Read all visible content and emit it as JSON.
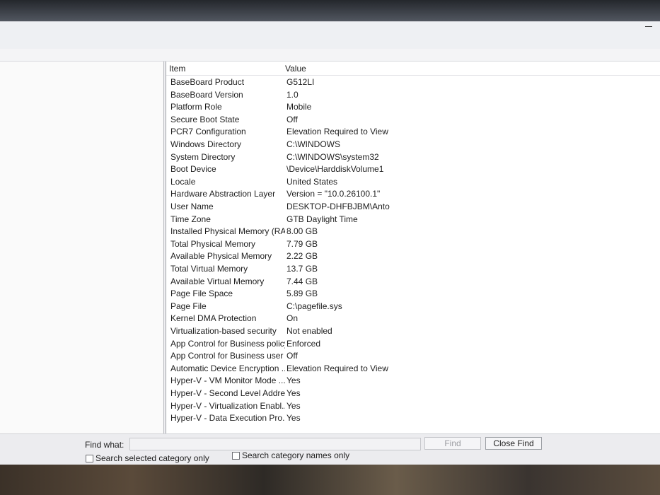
{
  "find_bar": {
    "label": "Find what:",
    "input_value": "",
    "find_label": "Find",
    "close_label": "Close Find",
    "option_selected_category": "Search selected category only",
    "option_category_names": "Search category names only"
  },
  "list": {
    "columns": {
      "item": "Item",
      "value": "Value"
    },
    "rows": [
      {
        "item": "BaseBoard Product",
        "value": "G512LI"
      },
      {
        "item": "BaseBoard Version",
        "value": "1.0"
      },
      {
        "item": "Platform Role",
        "value": "Mobile"
      },
      {
        "item": "Secure Boot State",
        "value": "Off"
      },
      {
        "item": "PCR7 Configuration",
        "value": "Elevation Required to View"
      },
      {
        "item": "Windows Directory",
        "value": "C:\\WINDOWS"
      },
      {
        "item": "System Directory",
        "value": "C:\\WINDOWS\\system32"
      },
      {
        "item": "Boot Device",
        "value": "\\Device\\HarddiskVolume1"
      },
      {
        "item": "Locale",
        "value": "United States"
      },
      {
        "item": "Hardware Abstraction Layer",
        "value": "Version = \"10.0.26100.1\""
      },
      {
        "item": "User Name",
        "value": "DESKTOP-DHFBJBM\\Anto"
      },
      {
        "item": "Time Zone",
        "value": "GTB Daylight Time"
      },
      {
        "item": "Installed Physical Memory (RA...",
        "value": "8.00 GB"
      },
      {
        "item": "Total Physical Memory",
        "value": "7.79 GB"
      },
      {
        "item": "Available Physical Memory",
        "value": "2.22 GB"
      },
      {
        "item": "Total Virtual Memory",
        "value": "13.7 GB"
      },
      {
        "item": "Available Virtual Memory",
        "value": "7.44 GB"
      },
      {
        "item": "Page File Space",
        "value": "5.89 GB"
      },
      {
        "item": "Page File",
        "value": "C:\\pagefile.sys"
      },
      {
        "item": "Kernel DMA Protection",
        "value": "On"
      },
      {
        "item": "Virtualization-based security",
        "value": "Not enabled"
      },
      {
        "item": "App Control for Business policy",
        "value": "Enforced"
      },
      {
        "item": "App Control for Business user ...",
        "value": "Off"
      },
      {
        "item": "Automatic Device Encryption ...",
        "value": "Elevation Required to View"
      },
      {
        "item": "Hyper-V - VM Monitor Mode ...",
        "value": "Yes"
      },
      {
        "item": "Hyper-V - Second Level Addre...",
        "value": "Yes"
      },
      {
        "item": "Hyper-V - Virtualization Enabl...",
        "value": "Yes"
      },
      {
        "item": "Hyper-V - Data Execution Pro...",
        "value": "Yes"
      }
    ]
  }
}
